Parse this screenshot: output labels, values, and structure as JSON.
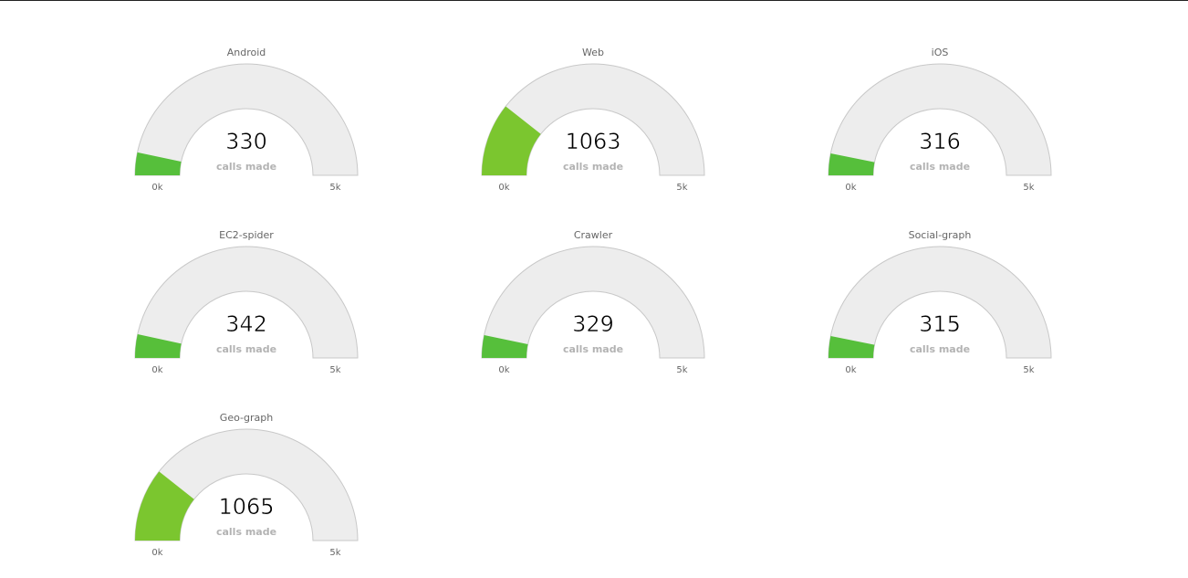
{
  "chart_data": {
    "type": "gauge",
    "min": 0,
    "max": 5000,
    "min_label": "0k",
    "max_label": "5k",
    "caption": "calls made",
    "colors": {
      "track": "#ededed",
      "track_border": "#c8c8c8",
      "fill_low": "#55bf3b",
      "fill_mid": "#7dc62e"
    },
    "gauges": [
      {
        "label": "Android",
        "value": 330,
        "value_label": "330"
      },
      {
        "label": "Web",
        "value": 1063,
        "value_label": "1063"
      },
      {
        "label": "iOS",
        "value": 316,
        "value_label": "316"
      },
      {
        "label": "EC2-spider",
        "value": 342,
        "value_label": "342"
      },
      {
        "label": "Crawler",
        "value": 329,
        "value_label": "329"
      },
      {
        "label": "Social-graph",
        "value": 315,
        "value_label": "315"
      },
      {
        "label": "Geo-graph",
        "value": 1065,
        "value_label": "1065"
      }
    ]
  }
}
